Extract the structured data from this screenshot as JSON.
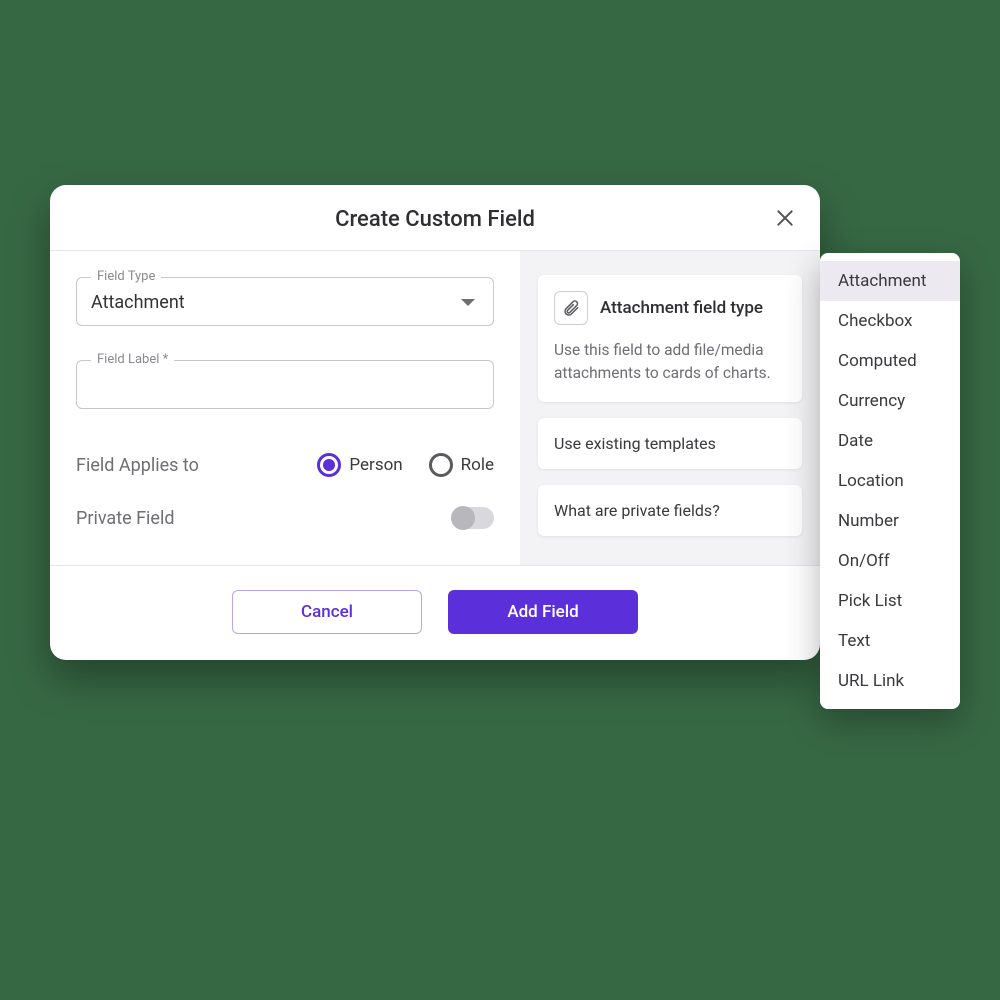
{
  "dialog": {
    "title": "Create Custom Field",
    "field_type": {
      "label": "Field Type",
      "value": "Attachment"
    },
    "field_label": {
      "label": "Field Label *",
      "value": ""
    },
    "applies_to": {
      "label": "Field Applies to",
      "options": {
        "person": "Person",
        "role": "Role"
      },
      "selected": "person"
    },
    "private_field": {
      "label": "Private Field",
      "enabled": false
    },
    "info": {
      "title": "Attachment field type",
      "description": "Use this field to add file/media attachments to cards of charts.",
      "templates_link": "Use existing templates",
      "private_link": "What are private fields?"
    },
    "buttons": {
      "cancel": "Cancel",
      "submit": "Add Field"
    }
  },
  "dropdown": {
    "items": [
      "Attachment",
      "Checkbox",
      "Computed",
      "Currency",
      "Date",
      "Location",
      "Number",
      "On/Off",
      "Pick List",
      "Text",
      "URL Link"
    ],
    "selected_index": 0
  }
}
